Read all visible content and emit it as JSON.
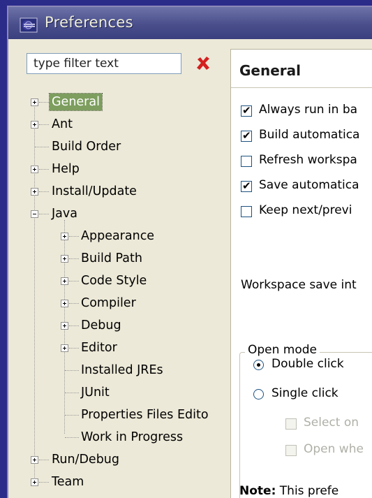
{
  "window": {
    "title": "Preferences"
  },
  "filter": {
    "placeholder": "type filter text",
    "value": "type filter text"
  },
  "tree": {
    "general": "General",
    "ant": "Ant",
    "build_order": "Build Order",
    "help": "Help",
    "install_update": "Install/Update",
    "java": "Java",
    "java_children": {
      "appearance": "Appearance",
      "build_path": "Build Path",
      "code_style": "Code Style",
      "compiler": "Compiler",
      "debug": "Debug",
      "editor": "Editor",
      "installed_jres": "Installed JREs",
      "junit": "JUnit",
      "properties_files_editor": "Properties Files Edito",
      "work_in_progress": "Work in Progress"
    },
    "run_debug": "Run/Debug",
    "team": "Team"
  },
  "page": {
    "title": "General",
    "options": {
      "always_run_bg": {
        "label": "Always run in ba",
        "checked": true
      },
      "build_auto": {
        "label": "Build automatica",
        "checked": true
      },
      "refresh_workspace": {
        "label": "Refresh workspa",
        "checked": false
      },
      "save_auto": {
        "label": "Save automatica",
        "checked": true
      },
      "keep_next_prev": {
        "label": "Keep next/previ",
        "checked": false
      }
    },
    "workspace_save_interval": "Workspace save int",
    "open_mode": {
      "title": "Open mode",
      "double_click": "Double click",
      "single_click": "Single click",
      "selected": "double_click",
      "select_on": "Select on",
      "open_when": "Open whe"
    },
    "note_label": "Note:",
    "note_text": "This prefe"
  },
  "colors": {
    "desktop": "#2b2b8a",
    "titlebar": "#4a4f8c",
    "selection": "#7d9e5e",
    "clear_icon": "#d42020"
  }
}
